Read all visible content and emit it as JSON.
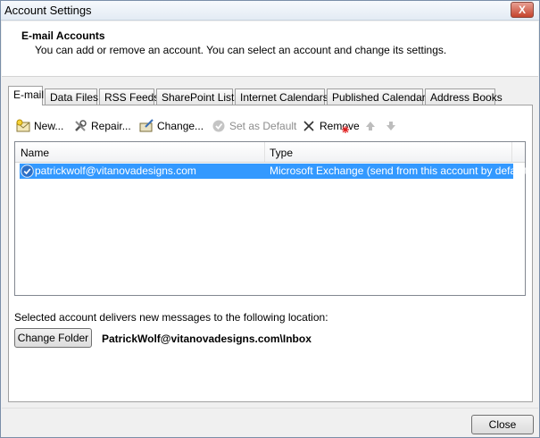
{
  "window": {
    "title": "Account Settings",
    "close_glyph": "X"
  },
  "header": {
    "title": "E-mail Accounts",
    "description": "You can add or remove an account. You can select an account and change its settings."
  },
  "tabs": [
    {
      "label": "E-mail",
      "active": true
    },
    {
      "label": "Data Files"
    },
    {
      "label": "RSS Feeds"
    },
    {
      "label": "SharePoint Lists"
    },
    {
      "label": "Internet Calendars"
    },
    {
      "label": "Published Calendars"
    },
    {
      "label": "Address Books"
    }
  ],
  "toolbar": {
    "new_label": "New...",
    "repair_label": "Repair...",
    "change_label": "Change...",
    "set_default_label": "Set as Default",
    "remove_label": "Remove"
  },
  "accounts_table": {
    "columns": [
      "Name",
      "Type"
    ],
    "rows": [
      {
        "name": "patrickwolf@vitanovadesigns.com",
        "type": "Microsoft Exchange (send from this account by default)",
        "selected": true
      }
    ]
  },
  "delivery": {
    "text": "Selected account delivers new messages to the following location:",
    "change_folder_label": "Change Folder",
    "location": "PatrickWolf@vitanovadesigns.com\\Inbox"
  },
  "footer": {
    "close_label": "Close"
  },
  "colors": {
    "selection": "#3399ff",
    "accent": "#2c6fc7"
  }
}
